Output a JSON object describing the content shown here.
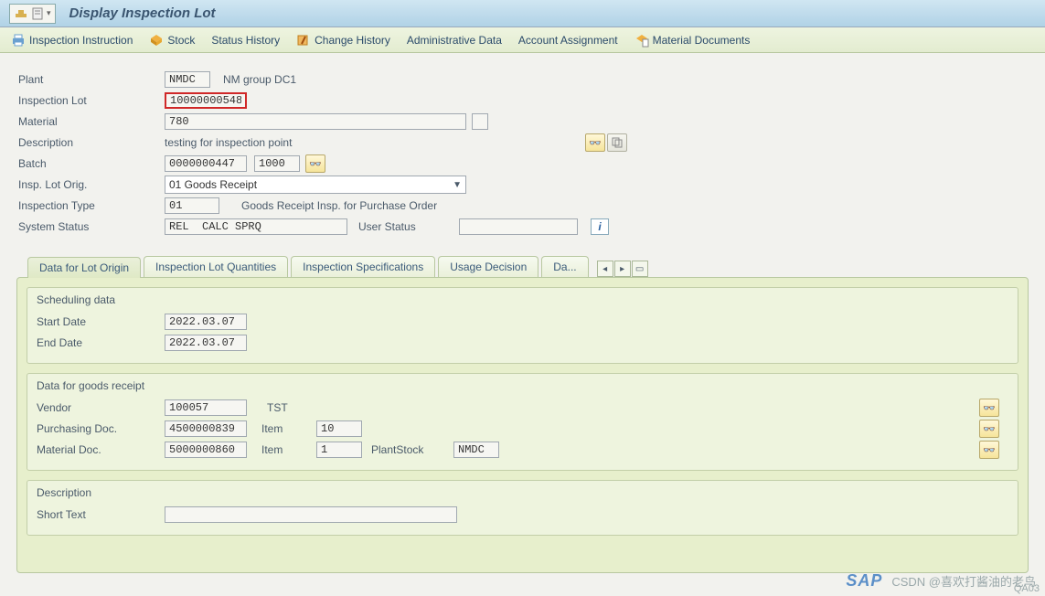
{
  "title": "Display Inspection Lot",
  "toolbar": {
    "inspection_instruction": "Inspection Instruction",
    "stock": "Stock",
    "status_history": "Status History",
    "change_history": "Change History",
    "admin_data": "Administrative Data",
    "account_assignment": "Account Assignment",
    "material_documents": "Material Documents"
  },
  "form": {
    "plant_label": "Plant",
    "plant_value": "NMDC",
    "plant_desc": "NM group DC1",
    "insp_lot_label": "Inspection Lot",
    "insp_lot_value": "10000000548",
    "material_label": "Material",
    "material_value": "780",
    "description_label": "Description",
    "description_value": "testing for inspection point",
    "batch_label": "Batch",
    "batch_value": "0000000447",
    "batch_extra": "1000",
    "insp_lot_orig_label": "Insp. Lot Orig.",
    "insp_lot_orig_value": "01 Goods Receipt",
    "insp_type_label": "Inspection Type",
    "insp_type_value": "01",
    "insp_type_desc": "Goods Receipt Insp. for Purchase Order",
    "system_status_label": "System Status",
    "system_status_value": "REL  CALC SPRQ",
    "user_status_label": "User Status",
    "user_status_value": ""
  },
  "tabs": {
    "t1": "Data for Lot Origin",
    "t2": "Inspection Lot Quantities",
    "t3": "Inspection Specifications",
    "t4": "Usage Decision",
    "t5": "Da..."
  },
  "scheduling": {
    "title": "Scheduling data",
    "start_label": "Start Date",
    "start_value": "2022.03.07",
    "end_label": "End Date",
    "end_value": "2022.03.07"
  },
  "goods": {
    "title": "Data for goods receipt",
    "vendor_label": "Vendor",
    "vendor_value": "100057",
    "vendor_name": "TST",
    "purchdoc_label": "Purchasing Doc.",
    "purchdoc_value": "4500000839",
    "item_label": "Item",
    "item1_value": "10",
    "matdoc_label": "Material Doc.",
    "matdoc_value": "5000000860",
    "item2_value": "1",
    "plantstock_label": "PlantStock",
    "plantstock_value": "NMDC"
  },
  "desc_group": {
    "title": "Description",
    "shorttext_label": "Short Text",
    "shorttext_value": ""
  },
  "watermark": "CSDN @喜欢打酱油的老鸟",
  "txn_code": "QA03",
  "icons": {
    "glasses": "👓",
    "info": "i"
  }
}
